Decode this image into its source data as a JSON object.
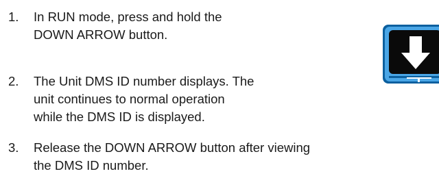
{
  "steps": [
    {
      "number": "1.",
      "text": "In RUN mode, press and hold the\nDOWN ARROW button."
    },
    {
      "number": "2.",
      "text": "The Unit DMS ID number displays. The\nunit continues to normal operation\nwhile the DMS ID is displayed."
    },
    {
      "number": "3.",
      "text": "Release the DOWN ARROW button after viewing\nthe DMS ID number."
    }
  ],
  "icon": {
    "name": "down-arrow-button-icon",
    "outer_color": "#0b5f9e",
    "highlight_color": "#4aa6e6",
    "inner_color": "#0a0a0a",
    "arrow_color": "#ffffff"
  }
}
